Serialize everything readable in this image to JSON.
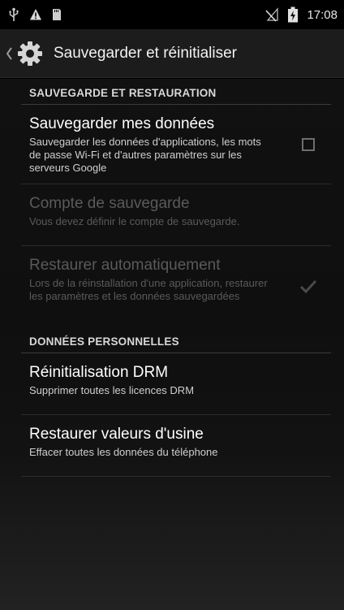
{
  "status": {
    "time": "17:08"
  },
  "actionbar": {
    "title": "Sauvegarder et réinitialiser"
  },
  "sections": [
    {
      "header": "SAUVEGARDE ET RESTAURATION",
      "items": [
        {
          "title": "Sauvegarder mes données",
          "summary": "Sauvegarder les données d'applications, les mots de passe Wi-Fi et d'autres paramètres sur les serveurs Google",
          "checked": false,
          "enabled": true
        },
        {
          "title": "Compte de sauvegarde",
          "summary": "Vous devez définir le compte de sauvegarde.",
          "enabled": false
        },
        {
          "title": "Restaurer automatiquement",
          "summary": "Lors de la réinstallation d'une application, restaurer les paramètres et les données sauvegardées",
          "checked": true,
          "enabled": false
        }
      ]
    },
    {
      "header": "DONNÉES PERSONNELLES",
      "items": [
        {
          "title": "Réinitialisation DRM",
          "summary": "Supprimer toutes les licences DRM",
          "enabled": true
        },
        {
          "title": "Restaurer valeurs d'usine",
          "summary": "Effacer toutes les données du téléphone",
          "enabled": true
        }
      ]
    }
  ],
  "icons": {
    "usb": "usb-icon",
    "warning": "warning-icon",
    "sdcard": "sd-card-icon",
    "signal": "no-signal-icon",
    "battery": "battery-charging-icon",
    "settings": "gear-icon",
    "up": "chevron-left-icon"
  },
  "colors": {
    "background": "#000000",
    "actionbar": "#1c1c1c",
    "divider": "#3b3b3b",
    "text": "#ffffff",
    "disabled_text": "#5a5a5a"
  }
}
